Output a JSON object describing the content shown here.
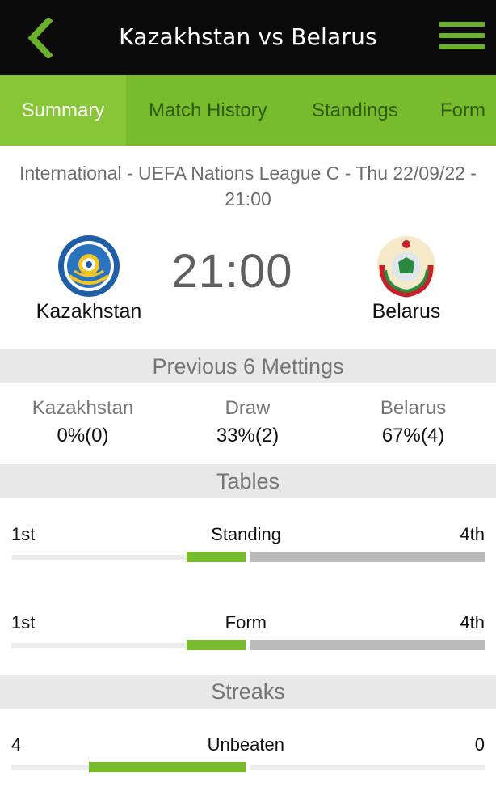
{
  "header": {
    "title": "Kazakhstan vs Belarus",
    "back_icon": "chevron-left-icon",
    "menu_icon": "hamburger-menu-icon",
    "accent_color": "#6cb12c"
  },
  "tabs": [
    {
      "label": "Summary",
      "active": true
    },
    {
      "label": "Match History",
      "active": false
    },
    {
      "label": "Standings",
      "active": false
    },
    {
      "label": "Form",
      "active": false
    }
  ],
  "match": {
    "info": "International - UEFA Nations League C - Thu 22/09/22 - 21:00",
    "home_team": "Kazakhstan",
    "away_team": "Belarus",
    "time": "21:00",
    "home_crest_icon": "kazakhstan-football-federation-crest-icon",
    "away_crest_icon": "belarus-coat-of-arms-icon"
  },
  "meetings": {
    "header": "Previous 6 Mettings",
    "home_label": "Kazakhstan",
    "home_value": "0%(0)",
    "draw_label": "Draw",
    "draw_value": "33%(2)",
    "away_label": "Belarus",
    "away_value": "67%(4)"
  },
  "tables": {
    "header": "Tables",
    "standing": {
      "label": "Standing",
      "home": "1st",
      "away": "4th"
    },
    "form": {
      "label": "Form",
      "home": "1st",
      "away": "4th"
    }
  },
  "streaks": {
    "header": "Streaks",
    "unbeaten": {
      "label": "Unbeaten",
      "home": "4",
      "away": "0"
    }
  }
}
